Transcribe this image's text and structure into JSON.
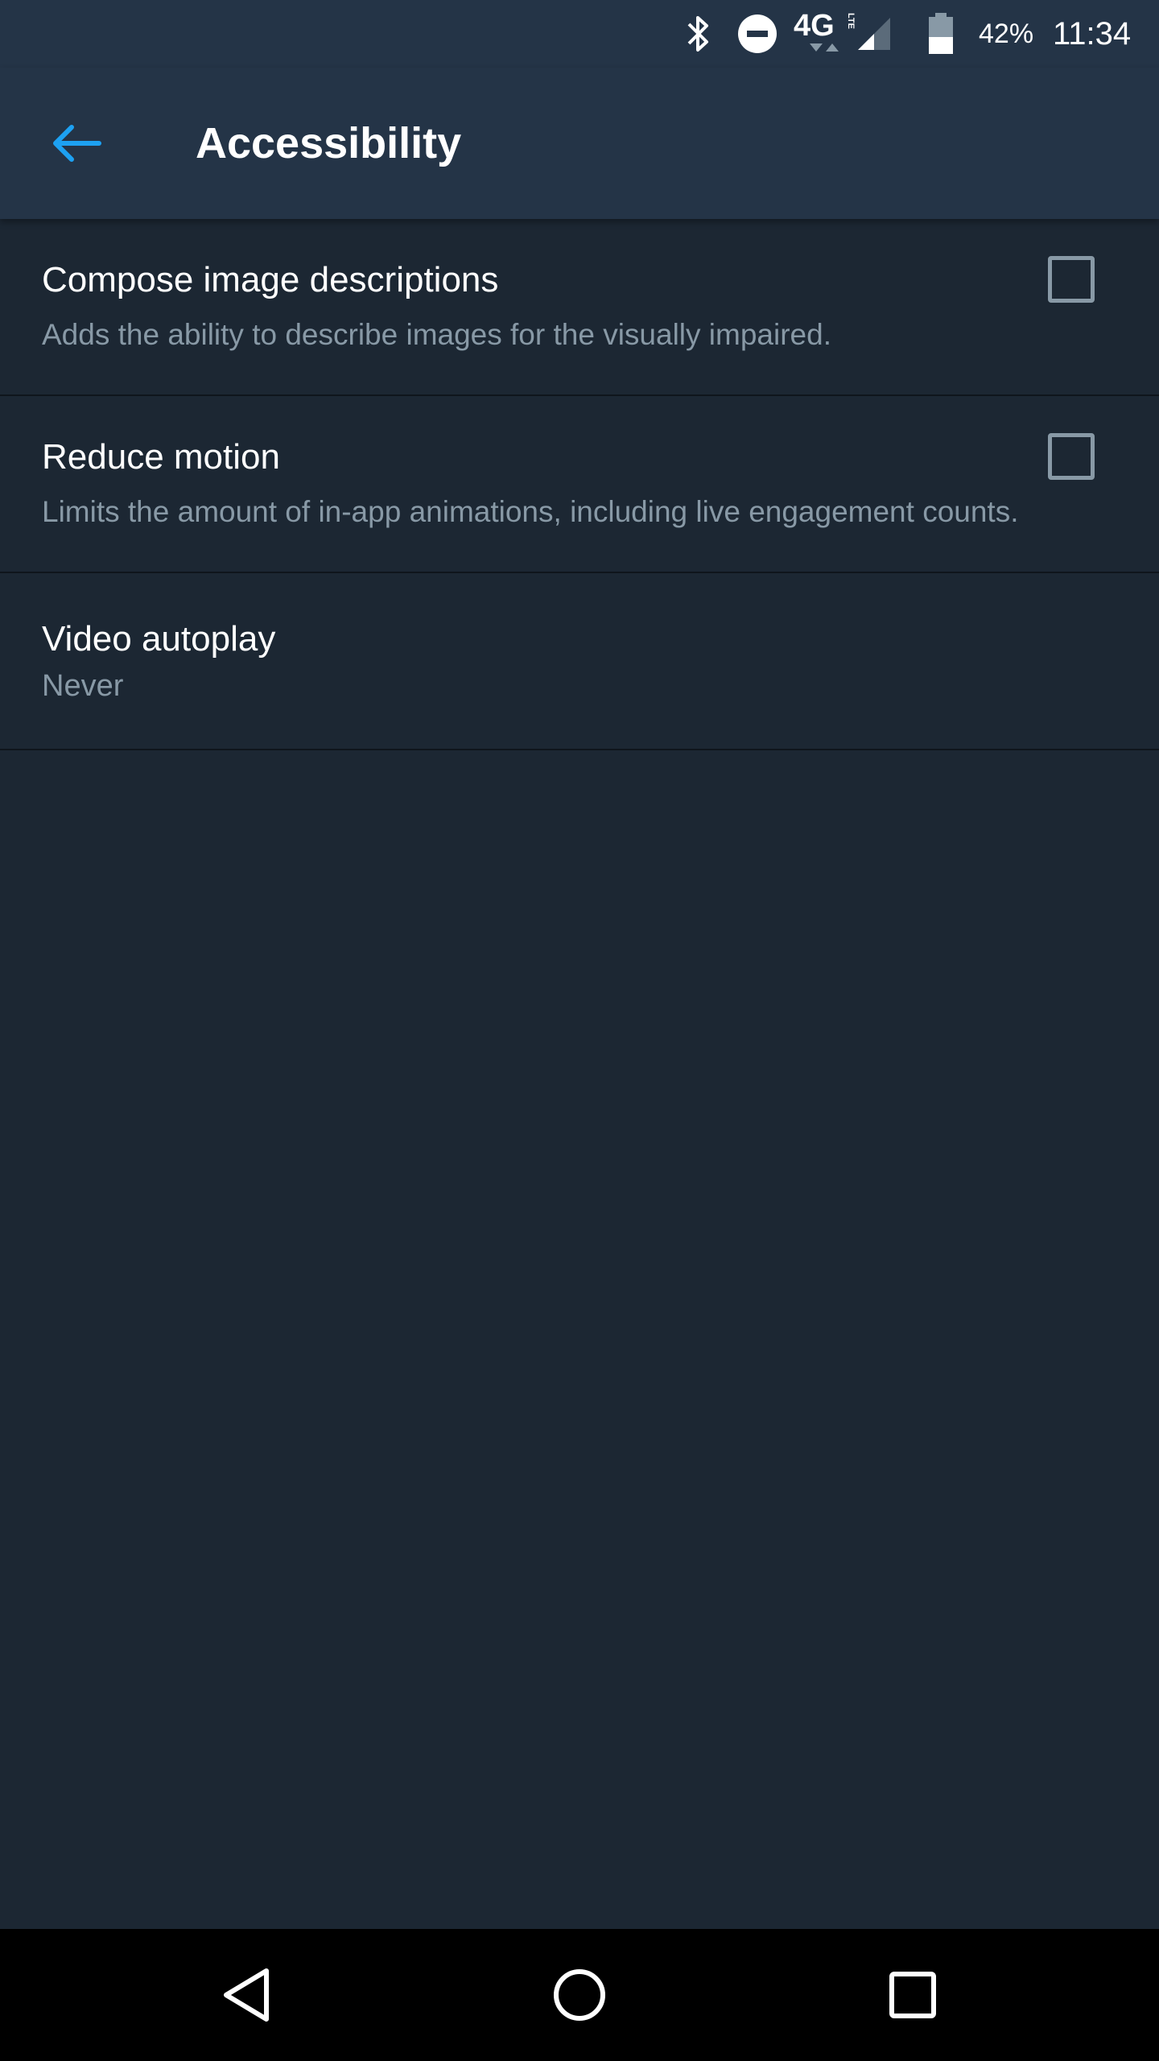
{
  "status_bar": {
    "network": "4G",
    "network_sub": "LTE",
    "battery_percent": "42%",
    "time": "11:34",
    "icons": [
      "bluetooth-icon",
      "do-not-disturb-icon",
      "4g-lte-icon",
      "signal-icon",
      "battery-icon"
    ]
  },
  "app_bar": {
    "back_icon": "arrow-left-icon",
    "title": "Accessibility",
    "accent_color": "#1da1f2"
  },
  "settings": [
    {
      "title": "Compose image descriptions",
      "description": "Adds the ability to describe images for the visually impaired.",
      "type": "checkbox",
      "checked": false
    },
    {
      "title": "Reduce motion",
      "description": "Limits the amount of in-app animations, including live engagement counts.",
      "type": "checkbox",
      "checked": false
    },
    {
      "title": "Video autoplay",
      "value": "Never",
      "type": "select"
    }
  ],
  "nav_bar": {
    "icons": [
      "back-triangle-icon",
      "home-circle-icon",
      "recents-square-icon"
    ]
  },
  "colors": {
    "background": "#1c2733",
    "header": "#243447",
    "secondary_text": "#8899a6",
    "divider": "#0f151c"
  }
}
